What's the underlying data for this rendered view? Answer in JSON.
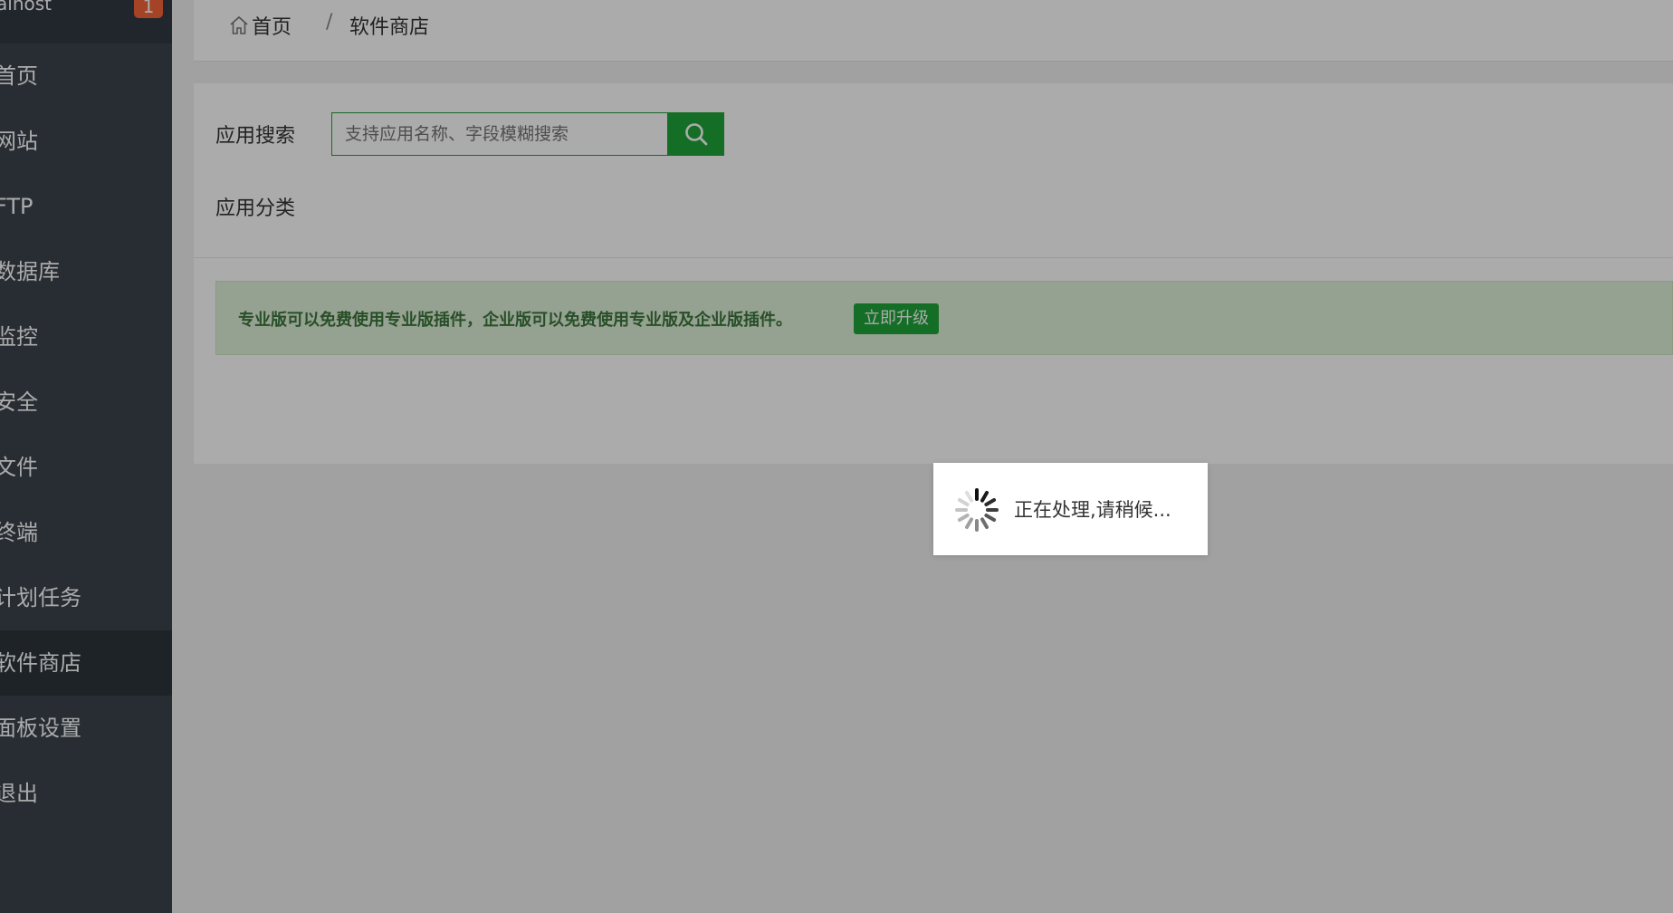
{
  "sidebar": {
    "hostname": "alhost",
    "badge": "1",
    "items": [
      {
        "label": "首页"
      },
      {
        "label": "网站"
      },
      {
        "label": "FTP"
      },
      {
        "label": "数据库"
      },
      {
        "label": "监控"
      },
      {
        "label": "安全"
      },
      {
        "label": "文件"
      },
      {
        "label": "终端"
      },
      {
        "label": "计划任务"
      },
      {
        "label": "软件商店"
      },
      {
        "label": "面板设置"
      },
      {
        "label": "退出"
      }
    ],
    "active": "软件商店"
  },
  "breadcrumb": {
    "home": "首页",
    "separator": "/",
    "current": "软件商店"
  },
  "search": {
    "label": "应用搜索",
    "placeholder": "支持应用名称、字段模糊搜索",
    "icon": "search-icon"
  },
  "category": {
    "label": "应用分类"
  },
  "notice": {
    "text": "专业版可以免费使用专业版插件，企业版可以免费使用专业版及企业版插件。",
    "button": "立即升级"
  },
  "loading": {
    "text": "正在处理,请稍候..."
  },
  "colors": {
    "accent": "#20a53a",
    "sidebar": "#3c444d",
    "badge": "#f7643a"
  }
}
